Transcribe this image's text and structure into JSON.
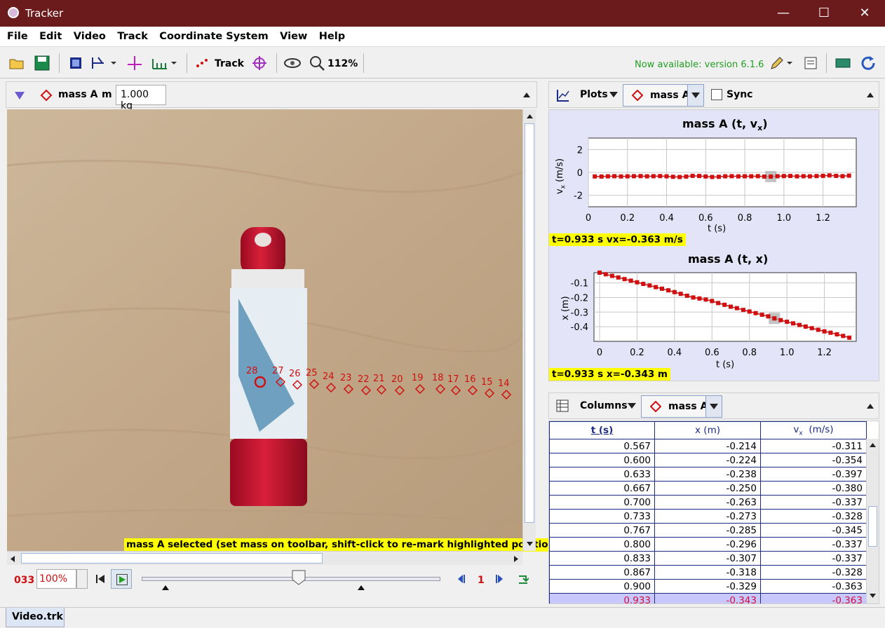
{
  "window": {
    "title": "Tracker"
  },
  "menu": [
    "File",
    "Edit",
    "Video",
    "Track",
    "Coordinate System",
    "View",
    "Help"
  ],
  "toolbar": {
    "track_label": "Track",
    "zoom": "112%",
    "update_notice": "Now available: version 6.1.6",
    "update_color": "#22a022"
  },
  "track_bar": {
    "track_name": "mass A",
    "mass_label": "m",
    "mass_value": "1.000 kg"
  },
  "video": {
    "status": "mass A selected (set mass on toolbar, shift-click to re-mark highlighted position)",
    "marker_labels": [
      "28",
      "27",
      "26",
      "25",
      "24",
      "23",
      "22",
      "21",
      "20",
      "19",
      "18",
      "17",
      "16",
      "15",
      "14"
    ],
    "marker_color": "#d01010"
  },
  "player": {
    "frame": "033",
    "rate": "100%",
    "step": "1"
  },
  "plots": {
    "button": "Plots",
    "track": "mass A",
    "sync": "Sync",
    "plot1": {
      "title": "mass A (t, v",
      "title_sub": "x",
      "ylabel_main": "v",
      "ylabel_sub": "x",
      "ylabel_unit": " (m/s)",
      "xlabel": "t (s)",
      "readout": "t=0.933 s  vx=-0.363 m/s",
      "yticks": [
        "2",
        "0",
        "-2"
      ],
      "xticks": [
        "0",
        "0.2",
        "0.4",
        "0.6",
        "0.8",
        "1.0",
        "1.2"
      ]
    },
    "plot2": {
      "title": "mass A (t, x)",
      "ylabel": "x (m)",
      "xlabel": "t (s)",
      "readout": "t=0.933 s  x=-0.343 m",
      "yticks": [
        "-0.1",
        "-0.2",
        "-0.3",
        "-0.4"
      ],
      "xticks": [
        "0",
        "0.2",
        "0.4",
        "0.6",
        "0.8",
        "1.0",
        "1.2"
      ]
    }
  },
  "columns": {
    "button": "Columns",
    "track": "mass A",
    "headers": [
      "t (s)",
      "x (m)",
      "v",
      "x",
      "(m/s)"
    ],
    "rows": [
      [
        "0.567",
        "-0.214",
        "-0.311"
      ],
      [
        "0.600",
        "-0.224",
        "-0.354"
      ],
      [
        "0.633",
        "-0.238",
        "-0.397"
      ],
      [
        "0.667",
        "-0.250",
        "-0.380"
      ],
      [
        "0.700",
        "-0.263",
        "-0.337"
      ],
      [
        "0.733",
        "-0.273",
        "-0.328"
      ],
      [
        "0.767",
        "-0.285",
        "-0.345"
      ],
      [
        "0.800",
        "-0.296",
        "-0.337"
      ],
      [
        "0.833",
        "-0.307",
        "-0.337"
      ],
      [
        "0.867",
        "-0.318",
        "-0.328"
      ],
      [
        "0.900",
        "-0.329",
        "-0.363"
      ],
      [
        "0.933",
        "-0.343",
        "-0.363"
      ]
    ],
    "selected_row": 11
  },
  "tabs": [
    "Video.trk"
  ],
  "chart_data": [
    {
      "type": "scatter",
      "title": "mass A (t, vx)",
      "xlabel": "t (s)",
      "ylabel": "vx (m/s)",
      "xlim": [
        0,
        1.37
      ],
      "ylim": [
        -3,
        3
      ],
      "x": [
        0.033,
        0.067,
        0.1,
        0.133,
        0.167,
        0.2,
        0.233,
        0.267,
        0.3,
        0.333,
        0.367,
        0.4,
        0.433,
        0.467,
        0.5,
        0.533,
        0.567,
        0.6,
        0.633,
        0.667,
        0.7,
        0.733,
        0.767,
        0.8,
        0.833,
        0.867,
        0.9,
        0.933,
        0.967,
        1.0,
        1.033,
        1.067,
        1.1,
        1.133,
        1.167,
        1.2,
        1.233,
        1.267,
        1.3,
        1.333
      ],
      "y": [
        -0.35,
        -0.36,
        -0.34,
        -0.33,
        -0.35,
        -0.34,
        -0.33,
        -0.32,
        -0.34,
        -0.33,
        -0.32,
        -0.34,
        -0.38,
        -0.4,
        -0.36,
        -0.3,
        -0.311,
        -0.354,
        -0.397,
        -0.38,
        -0.337,
        -0.328,
        -0.345,
        -0.337,
        -0.337,
        -0.328,
        -0.363,
        -0.363,
        -0.33,
        -0.32,
        -0.31,
        -0.34,
        -0.33,
        -0.34,
        -0.32,
        -0.3,
        -0.26,
        -0.3,
        -0.33,
        -0.28
      ],
      "highlight_x": 0.933
    },
    {
      "type": "scatter",
      "title": "mass A (t, x)",
      "xlabel": "t (s)",
      "ylabel": "x (m)",
      "xlim": [
        -0.03,
        1.37
      ],
      "ylim": [
        -0.5,
        -0.03
      ],
      "x": [
        0,
        0.033,
        0.067,
        0.1,
        0.133,
        0.167,
        0.2,
        0.233,
        0.267,
        0.3,
        0.333,
        0.367,
        0.4,
        0.433,
        0.467,
        0.5,
        0.533,
        0.567,
        0.6,
        0.633,
        0.667,
        0.7,
        0.733,
        0.767,
        0.8,
        0.833,
        0.867,
        0.9,
        0.933,
        0.967,
        1.0,
        1.033,
        1.067,
        1.1,
        1.133,
        1.167,
        1.2,
        1.233,
        1.267,
        1.3,
        1.333
      ],
      "y": [
        -0.03,
        -0.041,
        -0.052,
        -0.063,
        -0.074,
        -0.085,
        -0.096,
        -0.107,
        -0.118,
        -0.129,
        -0.14,
        -0.151,
        -0.163,
        -0.175,
        -0.188,
        -0.2,
        -0.207,
        -0.214,
        -0.224,
        -0.238,
        -0.25,
        -0.263,
        -0.273,
        -0.285,
        -0.296,
        -0.307,
        -0.318,
        -0.329,
        -0.343,
        -0.355,
        -0.366,
        -0.377,
        -0.388,
        -0.399,
        -0.41,
        -0.421,
        -0.432,
        -0.441,
        -0.452,
        -0.463,
        -0.475
      ],
      "highlight_x": 0.933
    }
  ]
}
